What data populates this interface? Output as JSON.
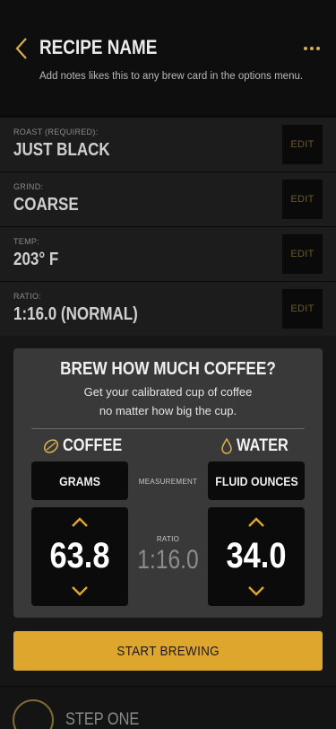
{
  "header": {
    "title": "RECIPE NAME",
    "notes": "Add notes likes this to any brew card in the options menu."
  },
  "settings": [
    {
      "label": "ROAST (REQUIRED):",
      "value": "JUST BLACK",
      "edit": "EDIT"
    },
    {
      "label": "GRIND:",
      "value": "COARSE",
      "edit": "EDIT"
    },
    {
      "label": "TEMP:",
      "value": "203° F",
      "edit": "EDIT"
    },
    {
      "label": "RATIO:",
      "value": "1:16.0 (NORMAL)",
      "edit": "EDIT"
    }
  ],
  "brew_card": {
    "title": "BREW HOW MUCH COFFEE?",
    "subtitle_line1": "Get your calibrated cup of coffee",
    "subtitle_line2": "no matter how big the cup.",
    "coffee": {
      "heading": "COFFEE",
      "unit": "GRAMS",
      "amount": "63.8"
    },
    "water": {
      "heading": "WATER",
      "unit": "FLUID OUNCES",
      "amount": "34.0"
    },
    "measurement_label": "MEASUREMENT",
    "ratio_label": "RATIO",
    "ratio_value": "1:16.0"
  },
  "start_button": "START BREWING",
  "step": {
    "label": "STEP ONE"
  },
  "colors": {
    "accent": "#dfa62d",
    "gold_icon": "#d6b04a",
    "background": "#0b0b0b",
    "card": "#393939"
  }
}
